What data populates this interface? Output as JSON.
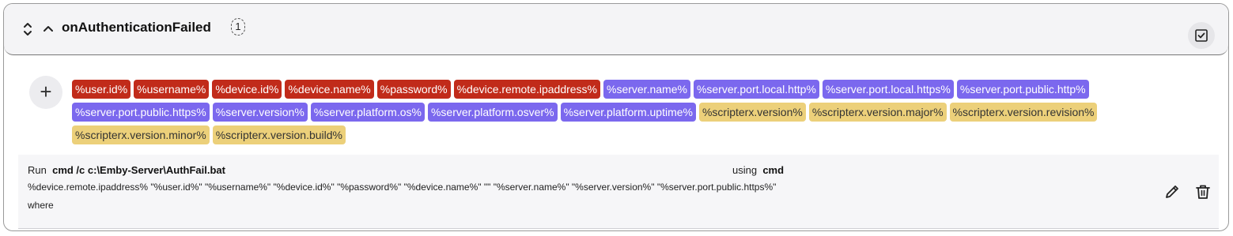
{
  "header": {
    "title": "onAuthenticationFailed",
    "count": "1",
    "icons": [
      "sort-icon",
      "chevron-up-icon",
      "checkbox-icon"
    ]
  },
  "add_button": {
    "label": "+"
  },
  "variables": [
    {
      "label": "%user.id%",
      "kind": "red"
    },
    {
      "label": "%username%",
      "kind": "red"
    },
    {
      "label": "%device.id%",
      "kind": "red"
    },
    {
      "label": "%device.name%",
      "kind": "red"
    },
    {
      "label": "%password%",
      "kind": "red"
    },
    {
      "label": "%device.remote.ipaddress%",
      "kind": "red"
    },
    {
      "label": "%server.name%",
      "kind": "purple"
    },
    {
      "label": "%server.port.local.http%",
      "kind": "purple"
    },
    {
      "label": "%server.port.local.https%",
      "kind": "purple"
    },
    {
      "label": "%server.port.public.http%",
      "kind": "purple"
    },
    {
      "label": "%server.port.public.https%",
      "kind": "purple"
    },
    {
      "label": "%server.version%",
      "kind": "purple"
    },
    {
      "label": "%server.platform.os%",
      "kind": "purple"
    },
    {
      "label": "%server.platform.osver%",
      "kind": "purple"
    },
    {
      "label": "%server.platform.uptime%",
      "kind": "purple"
    },
    {
      "label": "%scripterx.version%",
      "kind": "yellow"
    },
    {
      "label": "%scripterx.version.major%",
      "kind": "yellow"
    },
    {
      "label": "%scripterx.version.revision%",
      "kind": "yellow"
    },
    {
      "label": "%scripterx.version.minor%",
      "kind": "yellow"
    },
    {
      "label": "%scripterx.version.build%",
      "kind": "yellow"
    }
  ],
  "colors": {
    "red": "#c12b1a",
    "purple": "#7b68ee",
    "yellow": "#ecd07a"
  },
  "action": {
    "run_label": "Run",
    "command": "cmd /c c:\\Emby-Server\\AuthFail.bat",
    "using_label": "using",
    "using_value": "cmd",
    "arguments": "%device.remote.ipaddress% \"%user.id%\" \"%username%\" \"%device.id%\" \"%password%\" \"%device.name%\" \"\" \"%server.name%\" \"%server.version%\" \"%server.port.public.https%\"",
    "where_label": "where",
    "icons": [
      "pencil-icon",
      "trash-icon"
    ]
  }
}
